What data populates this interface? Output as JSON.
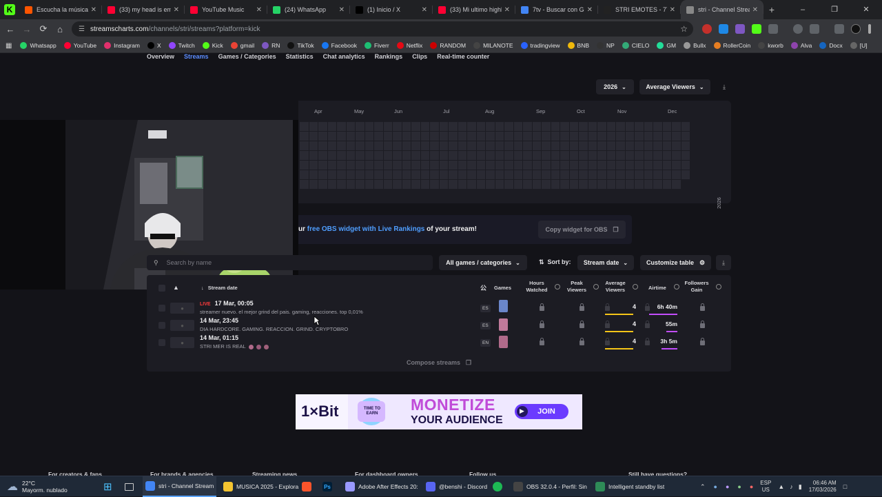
{
  "browser": {
    "tabs": [
      {
        "title": "Escucha la música d",
        "color": "#ff5500"
      },
      {
        "title": "(33) my head is emp",
        "color": "#ff0033"
      },
      {
        "title": "YouTube Music",
        "color": "#ff0033"
      },
      {
        "title": "(24) WhatsApp",
        "color": "#25d366"
      },
      {
        "title": "(1) Inicio / X",
        "color": "#000000"
      },
      {
        "title": "(33) Mi ultimo highl",
        "color": "#ff0033"
      },
      {
        "title": "7tv - Buscar con Go",
        "color": "#4285f4"
      },
      {
        "title": "STRI EMOTES - 7TV",
        "color": "#222222"
      },
      {
        "title": "stri - Channel Strea",
        "color": "#888888"
      }
    ],
    "url_domain": "streamscharts.com",
    "url_path": "/channels/stri/streams?platform=kick",
    "bookmarks": [
      "Whatsapp",
      "YouTube",
      "Instagram",
      "X",
      "Twitch",
      "Kick",
      "gmail",
      "RN",
      "TikTok",
      "Facebook",
      "Fiverr",
      "Netflix",
      "RANDOM",
      "MILANOTE",
      "tradingview",
      "BNB",
      "NP",
      "CIELO",
      "GM",
      "Bullx",
      "RollerCoin",
      "kworb",
      "Alva",
      "Docx",
      "[U]"
    ]
  },
  "subnav": {
    "items": [
      "Overview",
      "Streams",
      "Games / Categories",
      "Statistics",
      "Chat analytics",
      "Rankings",
      "Clips",
      "Real-time counter"
    ],
    "active": "Streams"
  },
  "heatmap": {
    "year_select": "2026",
    "metric_select": "Average Viewers",
    "months": [
      "Apr",
      "May",
      "Jun",
      "Jul",
      "Aug",
      "Sep",
      "Oct",
      "Nov",
      "Dec"
    ],
    "year_label": "2026"
  },
  "widget": {
    "text_prefix": "ur ",
    "text_link": "free OBS widget with Live Rankings",
    "text_suffix": " of your stream!",
    "button": "Copy widget for OBS"
  },
  "filters": {
    "search_placeholder": "Search by name",
    "games": "All games / categories",
    "sort_label": "Sort by:",
    "sort_value": "Stream date",
    "customize": "Customize table"
  },
  "table": {
    "headers": {
      "stream_date": "Stream date",
      "games": "Games",
      "hours_watched": "Hours Watched",
      "peak_viewers": "Peak Viewers",
      "average_viewers": "Average Viewers",
      "airtime": "Airtime",
      "followers_gain": "Followers Gain"
    },
    "rows": [
      {
        "live": "LIVE",
        "date": "17 Mar, 00:05",
        "title": "streamer nuevo. el mejor grind del pais. gaming, reacciones. top 0,01%",
        "lang": "ES",
        "avg": "4",
        "avg_fill": 0.9,
        "airtime": "6h 40m",
        "air_fill": 0.9
      },
      {
        "live": "",
        "date": "14 Mar, 23:45",
        "title": "DIA HARDCORE. GAMING. REACCION. GRIND. CRYPTOBRO",
        "lang": "ES",
        "avg": "4",
        "avg_fill": 0.9,
        "airtime": "55m",
        "air_fill": 0.35
      },
      {
        "live": "",
        "date": "14 Mar, 01:15",
        "title": "STRI MER IS REAL",
        "lang": "EN",
        "avg": "4",
        "avg_fill": 0.9,
        "airtime": "3h 5m",
        "air_fill": 0.5
      }
    ],
    "compose": "Compose streams"
  },
  "ad": {
    "brand": "1×Bit",
    "badge": "TIME TO EARN",
    "line1": "MONETIZE",
    "line2": "YOUR AUDIENCE",
    "cta": "JOIN"
  },
  "footer": [
    "For creators & fans",
    "For brands & agencies",
    "Streaming news",
    "For dashboard owners",
    "Follow us",
    "Still have questions?"
  ],
  "taskbar": {
    "weather_temp": "22°C",
    "weather_desc": "Mayorm. nublado",
    "apps": [
      {
        "label": "stri - Channel Stream",
        "color": "#4285f4"
      },
      {
        "label": "MUSICA 2025 - Explora",
        "color": "#f4c430"
      },
      {
        "label": "Adobe After Effects 20:",
        "color": "#9999ff"
      },
      {
        "label": "@benshi - Discord",
        "color": "#5865f2"
      },
      {
        "label": "OBS 32.0.4 - Perfil: Sin",
        "color": "#444444"
      },
      {
        "label": "Intelligent standby list",
        "color": "#2e8b57"
      }
    ],
    "lang": "ESP",
    "lang2": "US",
    "time": "06:46 AM",
    "date": "17/03/2026"
  }
}
